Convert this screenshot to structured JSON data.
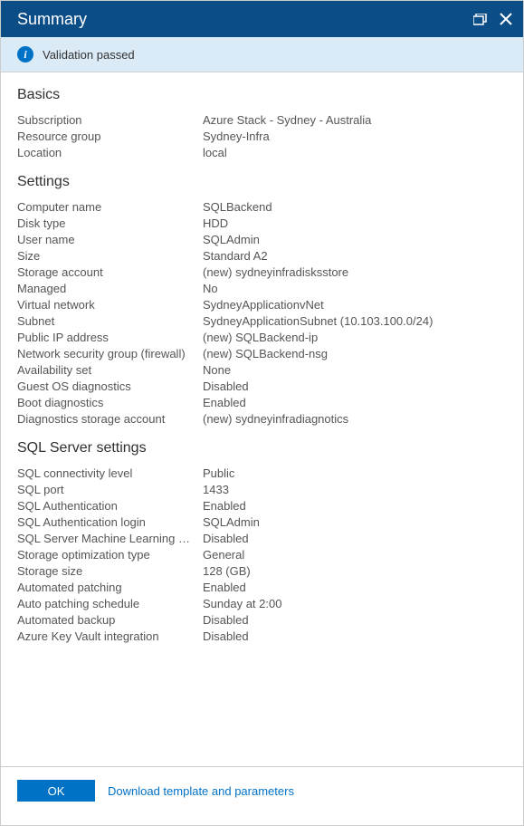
{
  "title": "Summary",
  "validation_message": "Validation passed",
  "sections": {
    "basics": {
      "title": "Basics",
      "subscription_label": "Subscription",
      "subscription_value": "Azure Stack - Sydney - Australia",
      "resource_group_label": "Resource group",
      "resource_group_value": "Sydney-Infra",
      "location_label": "Location",
      "location_value": "local"
    },
    "settings": {
      "title": "Settings",
      "computer_name_label": "Computer name",
      "computer_name_value": "SQLBackend",
      "disk_type_label": "Disk type",
      "disk_type_value": "HDD",
      "user_name_label": "User name",
      "user_name_value": "SQLAdmin",
      "size_label": "Size",
      "size_value": "Standard A2",
      "storage_account_label": "Storage account",
      "storage_account_value": "(new) sydneyinfradisksstore",
      "managed_label": "Managed",
      "managed_value": "No",
      "vnet_label": "Virtual network",
      "vnet_value": "SydneyApplicationvNet",
      "subnet_label": "Subnet",
      "subnet_value": "SydneyApplicationSubnet (10.103.100.0/24)",
      "pip_label": "Public IP address",
      "pip_value": "(new) SQLBackend-ip",
      "nsg_label": "Network security group (firewall)",
      "nsg_value": "(new) SQLBackend-nsg",
      "avset_label": "Availability set",
      "avset_value": "None",
      "guestdiag_label": "Guest OS diagnostics",
      "guestdiag_value": "Disabled",
      "bootdiag_label": "Boot diagnostics",
      "bootdiag_value": "Enabled",
      "diagstorage_label": "Diagnostics storage account",
      "diagstorage_value": "(new) sydneyinfradiagnotics"
    },
    "sql": {
      "title": "SQL Server settings",
      "conn_label": "SQL connectivity level",
      "conn_value": "Public",
      "port_label": "SQL port",
      "port_value": "1433",
      "auth_label": "SQL Authentication",
      "auth_value": "Enabled",
      "authlogin_label": "SQL Authentication login",
      "authlogin_value": "SQLAdmin",
      "ml_label": "SQL Server Machine Learning Services",
      "ml_value": "Disabled",
      "storageopt_label": "Storage optimization type",
      "storageopt_value": "General",
      "storagesize_label": "Storage size",
      "storagesize_value": "128 (GB)",
      "autopatch_label": "Automated patching",
      "autopatch_value": "Enabled",
      "patchsched_label": "Auto patching schedule",
      "patchsched_value": "Sunday at 2:00",
      "autobackup_label": "Automated backup",
      "autobackup_value": "Disabled",
      "keyvault_label": "Azure Key Vault integration",
      "keyvault_value": "Disabled"
    }
  },
  "footer": {
    "ok": "OK",
    "download_link": "Download template and parameters"
  }
}
